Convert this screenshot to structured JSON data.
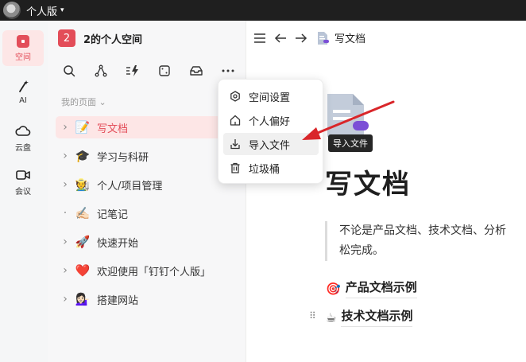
{
  "topbar": {
    "title": "个人版",
    "caret": "▾"
  },
  "leftnav": [
    {
      "label": "空间",
      "icon": "space-icon",
      "active": true
    },
    {
      "label": "AI",
      "icon": "ai-wand-icon"
    },
    {
      "label": "云盘",
      "icon": "cloud-icon"
    },
    {
      "label": "会议",
      "icon": "video-icon"
    }
  ],
  "space": {
    "badge": "2",
    "name": "2的个人空间"
  },
  "toolbar": [
    "search-icon",
    "graph-icon",
    "flash-icon",
    "square-icon",
    "inbox-icon",
    "more-icon"
  ],
  "section": {
    "title": "我的页面",
    "caret": "⌄"
  },
  "tree": [
    {
      "label": "写文档",
      "emoji": "📝",
      "chevron": "›",
      "active": true
    },
    {
      "label": "学习与科研",
      "emoji": "🎓",
      "chevron": "›"
    },
    {
      "label": "个人/项目管理",
      "emoji": "🧑‍🌾",
      "chevron": "›"
    },
    {
      "label": "记笔记",
      "emoji": "✍🏻",
      "chevron": "·"
    },
    {
      "label": "快速开始",
      "emoji": "🚀",
      "chevron": "›"
    },
    {
      "label": "欢迎使用「钉钉个人版」",
      "emoji": "❤️",
      "chevron": "›"
    },
    {
      "label": "搭建网站",
      "emoji": "💁🏻‍♀️",
      "chevron": "›"
    }
  ],
  "menu": [
    {
      "label": "空间设置",
      "icon": "settings-icon"
    },
    {
      "label": "个人偏好",
      "icon": "home-icon"
    },
    {
      "label": "导入文件",
      "icon": "import-icon",
      "hover": true
    },
    {
      "label": "垃圾桶",
      "icon": "trash-icon"
    }
  ],
  "main": {
    "breadcrumb": "写文档",
    "tooltip": "导入文件",
    "title": "写文档",
    "quote_line1": "不论是产品文档、技术文档、分析",
    "quote_line2": "松完成。",
    "headings": [
      {
        "emoji": "🎯",
        "text": "产品文档示例"
      },
      {
        "emoji": "☕",
        "text": "技术文档示例"
      }
    ]
  },
  "colors": {
    "accent": "#e34d59",
    "accent_bg": "#fde6e6",
    "arrow": "#d9262a",
    "topbar": "#1f1f1f"
  }
}
